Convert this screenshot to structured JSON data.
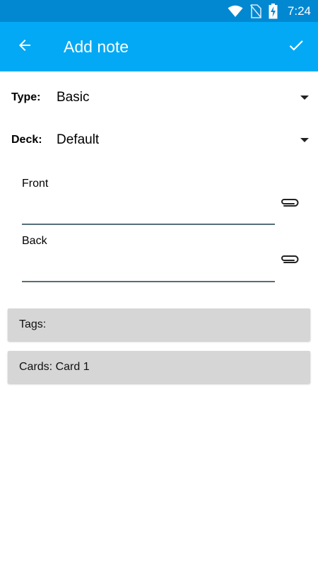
{
  "status_bar": {
    "time": "7:24",
    "icons": [
      "wifi-icon",
      "no-sim-icon",
      "battery-charging-icon"
    ]
  },
  "app_bar": {
    "title": "Add note",
    "back_icon": "arrow-back-icon",
    "save_icon": "check-icon"
  },
  "type_row": {
    "label": "Type:",
    "value": "Basic"
  },
  "deck_row": {
    "label": "Deck:",
    "value": "Default"
  },
  "fields": [
    {
      "label": "Front",
      "value": ""
    },
    {
      "label": "Back",
      "value": ""
    }
  ],
  "tags_button": {
    "label": "Tags:"
  },
  "cards_button": {
    "label": "Cards: Card 1"
  },
  "colors": {
    "status_bar": "#0288d1",
    "app_bar": "#03a9f4",
    "button_bg": "#d6d6d6"
  }
}
